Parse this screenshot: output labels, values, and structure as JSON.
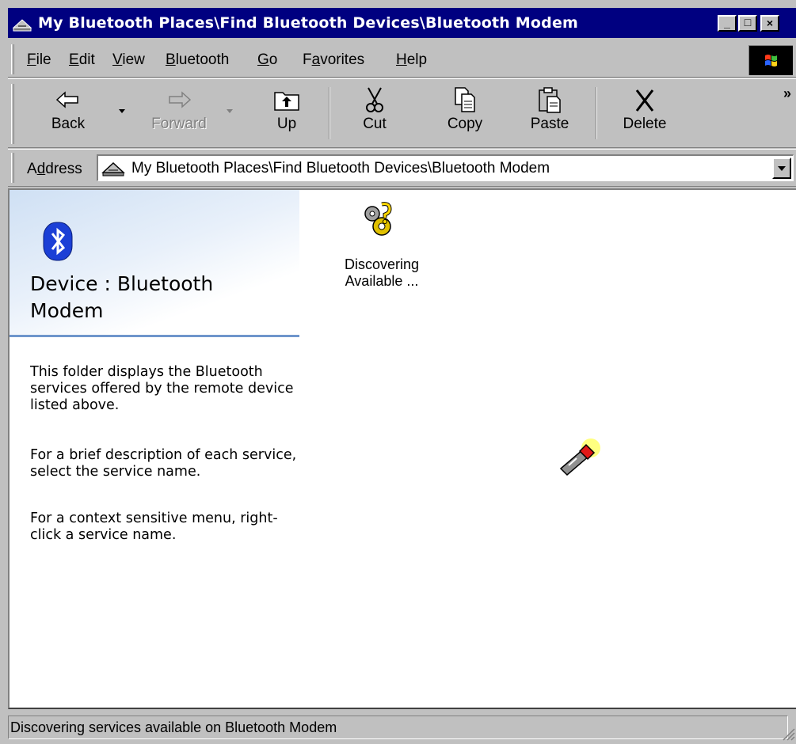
{
  "window": {
    "title": "My Bluetooth Places\\Find Bluetooth Devices\\Bluetooth Modem",
    "controls": {
      "minimize": "_",
      "maximize": "□",
      "close": "×"
    }
  },
  "menu": {
    "items": [
      {
        "pre": "",
        "key": "F",
        "post": "ile"
      },
      {
        "pre": "",
        "key": "E",
        "post": "dit"
      },
      {
        "pre": "",
        "key": "V",
        "post": "iew"
      },
      {
        "pre": "",
        "key": "B",
        "post": "luetooth"
      },
      {
        "pre": "",
        "key": "G",
        "post": "o"
      },
      {
        "pre": "F",
        "key": "a",
        "post": "vorites"
      },
      {
        "pre": "",
        "key": "H",
        "post": "elp"
      }
    ]
  },
  "toolbar": {
    "back": "Back",
    "forward": "Forward",
    "up": "Up",
    "cut": "Cut",
    "copy": "Copy",
    "paste": "Paste",
    "delete": "Delete",
    "more": "»"
  },
  "address": {
    "label_pre": "A",
    "label_key": "d",
    "label_post": "dress",
    "value": "My Bluetooth Places\\Find Bluetooth Devices\\Bluetooth Modem"
  },
  "pane": {
    "title": "Device : Bluetooth Modem",
    "paragraphs": [
      "This folder displays the Bluetooth services offered by the remote device listed above.",
      "For a brief description of each service, select the service name.",
      "For a context sensitive menu, right-click a service name."
    ]
  },
  "items": {
    "discovering_line1": "Discovering",
    "discovering_line2": "Available ..."
  },
  "status": {
    "text": "Discovering services available on Bluetooth Modem"
  },
  "icons": [
    "bluetooth-places-icon",
    "back-arrow-icon",
    "forward-arrow-icon",
    "up-folder-icon",
    "scissors-icon",
    "copy-icon",
    "paste-icon",
    "delete-x-icon",
    "bluetooth-logo-icon",
    "discovering-gears-icon",
    "flashlight-icon",
    "windows-logo-icon"
  ],
  "colors": {
    "titlebar": "#000080",
    "chrome": "#c0c0c0",
    "pane_divider": "#6f96cc"
  }
}
